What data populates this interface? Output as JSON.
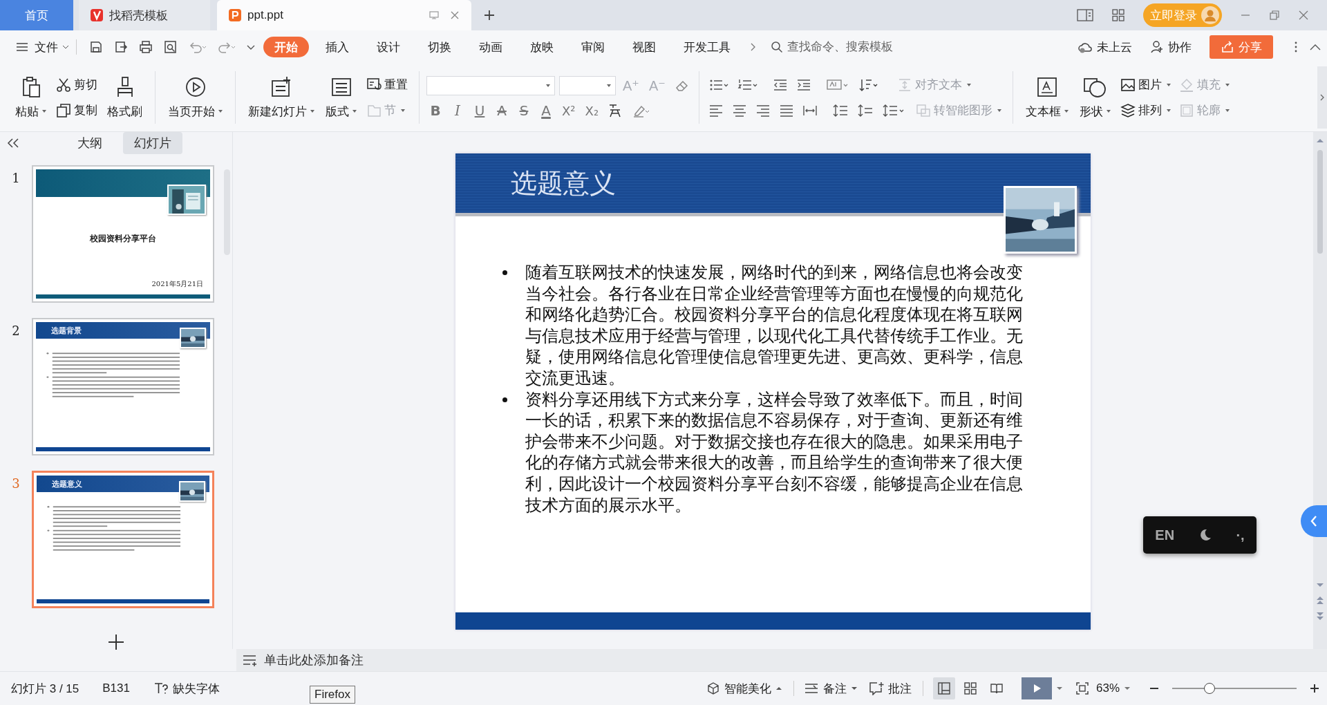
{
  "tabs": [
    {
      "label": "首页",
      "kind": "home",
      "selected": false
    },
    {
      "label": "找稻壳模板",
      "kind": "docer",
      "selected": false
    },
    {
      "label": "ppt.ppt",
      "kind": "document",
      "selected": true
    }
  ],
  "login_button": "立即登录",
  "menu": {
    "file": "文件",
    "tabs": [
      {
        "label": "开始",
        "selected": true
      },
      {
        "label": "插入",
        "selected": false
      },
      {
        "label": "设计",
        "selected": false
      },
      {
        "label": "切换",
        "selected": false
      },
      {
        "label": "动画",
        "selected": false
      },
      {
        "label": "放映",
        "selected": false
      },
      {
        "label": "审阅",
        "selected": false
      },
      {
        "label": "视图",
        "selected": false
      },
      {
        "label": "开发工具",
        "selected": false
      }
    ],
    "search": {
      "placeholder": "查找命令、搜索模板"
    },
    "cloud": "未上云",
    "collaborate": "协作",
    "share": "分享"
  },
  "ribbon": {
    "paste": {
      "label": "粘贴",
      "disabled": false
    },
    "cut": {
      "label": "剪切",
      "disabled": false
    },
    "copy": {
      "label": "复制",
      "disabled": false
    },
    "format_painter": {
      "label": "格式刷",
      "disabled": false
    },
    "play_current": {
      "label": "当页开始",
      "disabled": false
    },
    "new_slide": {
      "label": "新建幻灯片",
      "disabled": false
    },
    "layout": {
      "label": "版式",
      "disabled": false
    },
    "reset": {
      "label": "重置",
      "disabled": false
    },
    "section": {
      "label": "节",
      "disabled": true
    },
    "font_size_tools": [
      {
        "label": "A⁺",
        "disabled": true
      },
      {
        "label": "A⁻",
        "disabled": true
      }
    ],
    "format_buttons": [
      "B",
      "I",
      "U",
      "A",
      "S",
      "A",
      "X²",
      "X₂"
    ],
    "align_text": {
      "label": "对齐文本",
      "disabled": true
    },
    "smart_graphic": {
      "label": "转智能图形",
      "disabled": true
    },
    "text_box": {
      "label": "文本框",
      "disabled": false
    },
    "shape": {
      "label": "形状",
      "disabled": false
    },
    "picture": {
      "label": "图片",
      "disabled": false
    },
    "arrange": {
      "label": "排列",
      "disabled": false
    },
    "fill": {
      "label": "填充",
      "disabled": true
    },
    "outline": {
      "label": "轮廓",
      "disabled": true
    }
  },
  "panel_tabs": [
    {
      "label": "大纲",
      "selected": false
    },
    {
      "label": "幻灯片",
      "selected": true
    }
  ],
  "slides": [
    {
      "number": "1",
      "kind": "title",
      "title": "校园资料分享平台",
      "date": "2021年5月21日",
      "selected": false
    },
    {
      "number": "2",
      "kind": "content",
      "title": "选题背景",
      "selected": false
    },
    {
      "number": "3",
      "kind": "content",
      "title": "选题意义",
      "selected": true
    }
  ],
  "slide": {
    "title": "选题意义",
    "bullets": [
      "随着互联网技术的快速发展，网络时代的到来，网络信息也将会改变当今社会。各行各业在日常企业经营管理等方面也在慢慢的向规范化和网络化趋势汇合。校园资料分享平台的信息化程度体现在将互联网与信息技术应用于经营与管理，以现代化工具代替传统手工作业。无疑，使用网络信息化管理使信息管理更先进、更高效、更科学，信息交流更迅速。",
      "资料分享还用线下方式来分享，这样会导致了效率低下。而且，时间一长的话，积累下来的数据信息不容易保存，对于查询、更新还有维护会带来不少问题。对于数据交接也存在很大的隐患。如果采用电子化的存储方式就会带来很大的改善，而且给学生的查询带来了很大便利，因此设计一个校园资料分享平台刻不容缓，能够提高企业在信息技术方面的展示水平。"
    ]
  },
  "notes": {
    "placeholder": "单击此处添加备注"
  },
  "ime": {
    "mode": "EN",
    "punctuation": "·,"
  },
  "tooltip": "Firefox",
  "status_bar": {
    "slide_count": "幻灯片 3 / 15",
    "theme": "B131",
    "missing_fonts": "缺失字体",
    "beautify": "智能美化",
    "notes": "备注",
    "comments": "批注",
    "views": [
      {
        "kind": "normal",
        "selected": true
      },
      {
        "kind": "sorter",
        "selected": false
      },
      {
        "kind": "reading",
        "selected": false
      }
    ],
    "zoom": "63%",
    "zoom_slider": {
      "level": 0.3
    }
  }
}
